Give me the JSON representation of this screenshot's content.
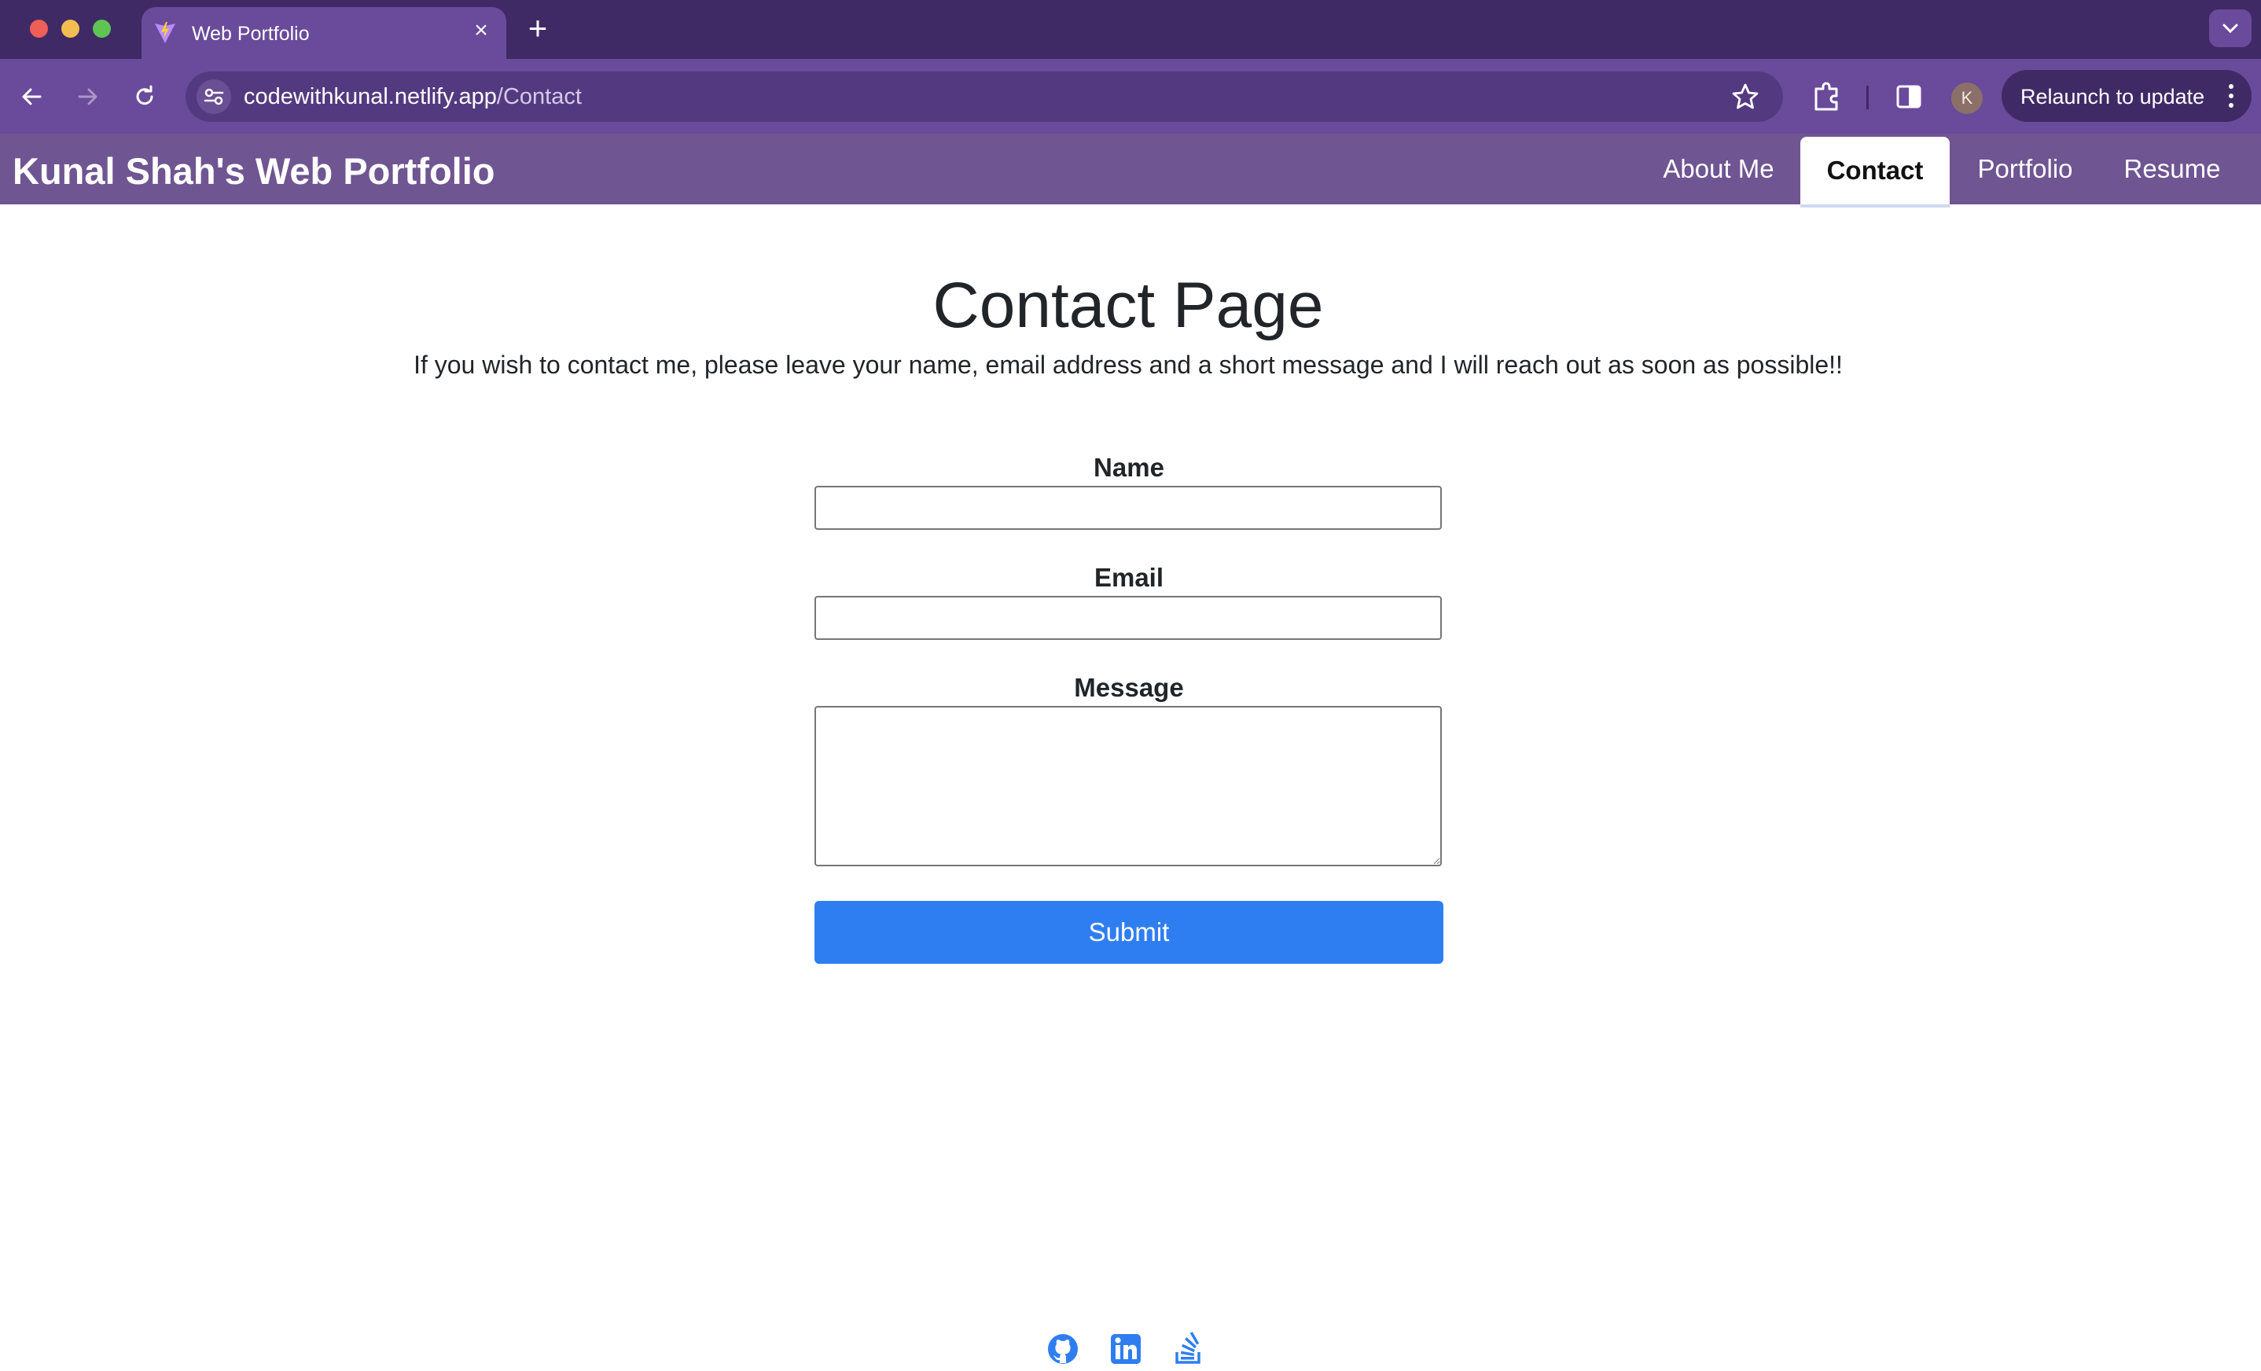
{
  "browser": {
    "tab": {
      "title": "Web Portfolio"
    },
    "omnibox": {
      "host": "codewithkunal.netlify.app",
      "path": "/Contact"
    },
    "profile_initial": "K",
    "relaunch_label": "Relaunch to update",
    "colors": {
      "tabbar": "#3f2a66",
      "toolbar": "#6a4a9a"
    }
  },
  "site": {
    "brand": "Kunal Shah's Web Portfolio",
    "nav": [
      {
        "label": "About Me",
        "active": false
      },
      {
        "label": "Contact",
        "active": true
      },
      {
        "label": "Portfolio",
        "active": false
      },
      {
        "label": "Resume",
        "active": false
      }
    ],
    "colors": {
      "navbar": "#6f5592",
      "accent": "#2f7ef1"
    }
  },
  "contact": {
    "title": "Contact Page",
    "intro": "If you wish to contact me, please leave your name, email address and a short message and I will reach out as soon as possible!!",
    "fields": {
      "name": {
        "label": "Name",
        "value": ""
      },
      "email": {
        "label": "Email",
        "value": ""
      },
      "message": {
        "label": "Message",
        "value": ""
      }
    },
    "submit_label": "Submit"
  },
  "footer": {
    "icons": [
      "github-icon",
      "linkedin-icon",
      "stackoverflow-icon"
    ]
  }
}
